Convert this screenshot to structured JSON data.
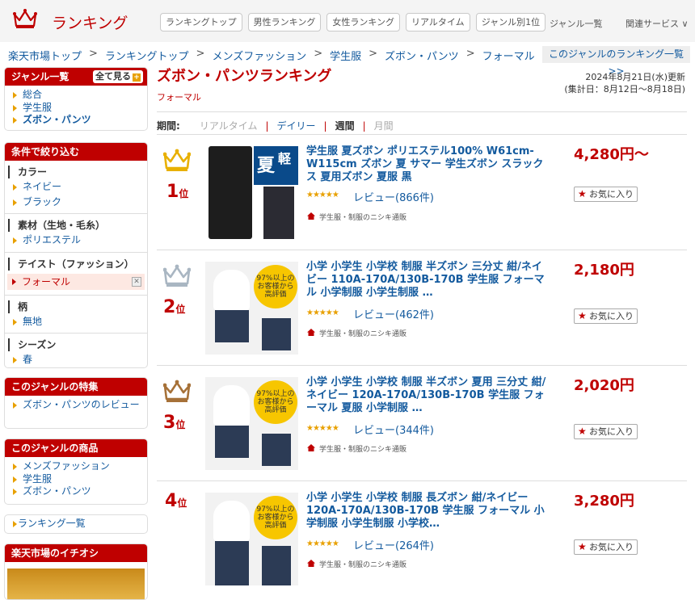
{
  "header": {
    "logo_text": "ランキング",
    "nav": [
      "ランキングトップ",
      "男性ランキング",
      "女性ランキング",
      "リアルタイム",
      "ジャンル別1位"
    ],
    "genre_list": "ジャンル一覧",
    "related": "関連サービス ∨"
  },
  "breadcrumb": [
    "楽天市場トップ",
    "ランキングトップ",
    "メンズファッション",
    "学生服",
    "ズボン・パンツ",
    "フォーマル"
  ],
  "breadcrumb_sep": ">",
  "genre_ranking_link": "このジャンルのランキング一覧 >>",
  "sidebar": {
    "genre_box": {
      "title": "ジャンル一覧",
      "see_all": "全て見る",
      "items": [
        "総合",
        "学生服",
        "ズボン・パンツ"
      ]
    },
    "filter_box": {
      "title": "条件で絞り込む",
      "groups": [
        {
          "name": "カラー",
          "options": [
            "ネイビー",
            "ブラック"
          ]
        },
        {
          "name": "素材（生地・毛糸）",
          "options": [
            "ポリエステル"
          ]
        },
        {
          "name": "テイスト（ファッション）",
          "selected": "フォーマル"
        },
        {
          "name": "柄",
          "options": [
            "無地"
          ]
        },
        {
          "name": "シーズン",
          "options": [
            "春"
          ]
        }
      ]
    },
    "feature_box": {
      "title": "このジャンルの特集",
      "items": [
        "ズボン・パンツのレビュー"
      ]
    },
    "products_box": {
      "title": "このジャンルの商品",
      "items": [
        "メンズファッション",
        "学生服",
        "ズボン・パンツ"
      ]
    },
    "ranking_list": "ランキング一覧",
    "pickup_title": "楽天市場のイチオシ"
  },
  "main": {
    "title": "ズボン・パンツランキング",
    "subtitle": "フォーマル",
    "update_date": "2024年8月21日(水)更新",
    "period_range": "(集計日：8月12日～8月18日)",
    "period_label": "期間:",
    "periods": [
      "リアルタイム",
      "デイリー",
      "週間",
      "月間"
    ],
    "period_sep": "|",
    "rank_suffix": "位",
    "fav_label": "お気に入り",
    "items": [
      {
        "rank": "1",
        "title": "学生服 夏ズボン ポリエステル100% W61cm-W115cm ズボン 夏 サマー 学生ズボン スラックス 夏用ズボン 夏服 黒",
        "price": "4,280円～",
        "stars": "★★★★★",
        "review": "レビュー(866件)",
        "shop": "学生服・制服のニシキ通販",
        "crown_color": "#e8b000"
      },
      {
        "rank": "2",
        "title": "小学 小学生 小学校 制服 半ズボン 三分丈 紺/ネイビー 110A-170A/130B-170B 学生服 フォーマル 小学制服 小学生制服 …",
        "price": "2,180円",
        "stars": "★★★★★",
        "review": "レビュー(462件)",
        "shop": "学生服・制服のニシキ通販",
        "crown_color": "#a9b6c2"
      },
      {
        "rank": "3",
        "title": "小学 小学生 小学校 制服 半ズボン 夏用 三分丈 紺/ネイビー 120A-170A/130B-170B 学生服 フォーマル 夏服 小学制服 …",
        "price": "2,020円",
        "stars": "★★★★★",
        "review": "レビュー(344件)",
        "shop": "学生服・制服のニシキ通販",
        "crown_color": "#a67138"
      },
      {
        "rank": "4",
        "title": "小学 小学生 小学校 制服 長ズボン 紺/ネイビー 120A-170A/130B-170B 学生服 フォーマル 小学制服 小学生制服 小学校…",
        "price": "3,280円",
        "stars": "★★★★★",
        "review": "レビュー(264件)",
        "shop": "学生服・制服のニシキ通販"
      }
    ],
    "thumb1_text": "夏",
    "thumb1_text2": "軽",
    "thumb_badge": "97%以上の お客様から 高評価"
  },
  "colors": {
    "brand": "#bf0000",
    "link": "#135a9e",
    "star": "#e8a000"
  }
}
